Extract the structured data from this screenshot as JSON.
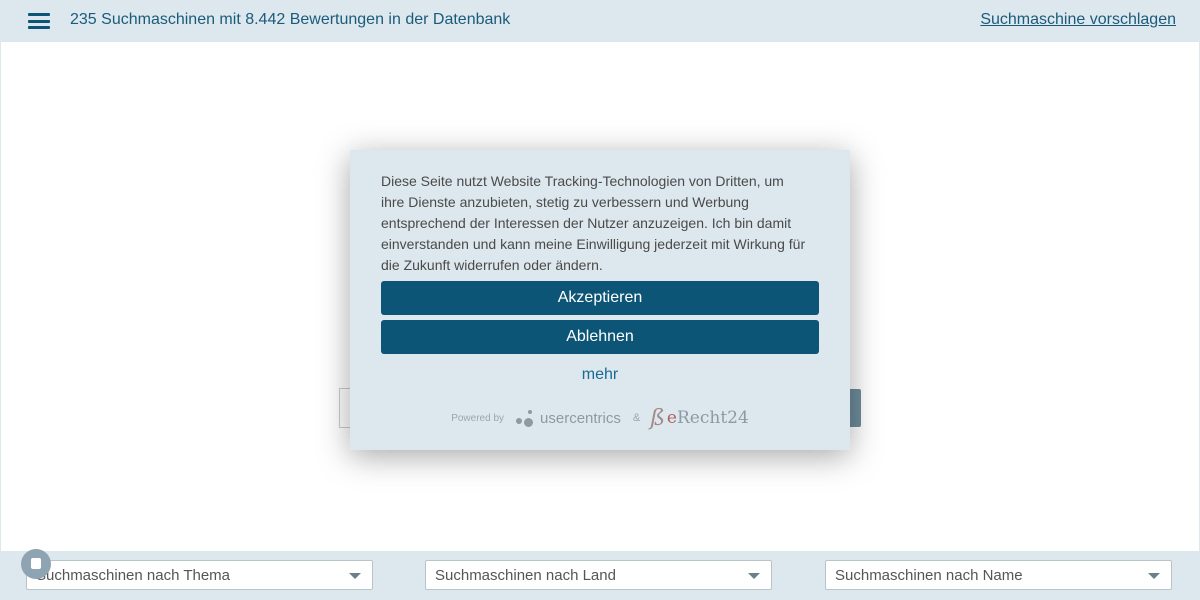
{
  "header": {
    "menu_icon": "hamburger-icon",
    "title": "235 Suchmaschinen mit 8.442 Bewertungen in der Datenbank",
    "suggest_link": "Suchmaschine vorschlagen"
  },
  "consent": {
    "text": "Diese Seite nutzt Website Tracking-Technologien von Dritten, um ihre Dienste anzubieten, stetig zu verbessern und Werbung entsprechend der Interessen der Nutzer anzuzeigen. Ich bin damit einverstanden und kann meine Einwilligung jederzeit mit Wirkung für die Zukunft widerrufen oder ändern.",
    "accept_label": "Akzeptieren",
    "decline_label": "Ablehnen",
    "more_label": "mehr",
    "powered_by": "Powered by",
    "provider_usercentrics": "usercentrics",
    "ampersand": "&",
    "provider_erecht_mark": "ß",
    "provider_erecht_e": "e",
    "provider_erecht_rest": "Recht24"
  },
  "footer": {
    "selects": [
      {
        "label": "Suchmaschinen nach Thema"
      },
      {
        "label": "Suchmaschinen nach Land"
      },
      {
        "label": "Suchmaschinen nach Name"
      }
    ]
  },
  "colors": {
    "accent": "#0d5576",
    "bar_background": "#dde8ee",
    "link": "#1b5b7a"
  }
}
